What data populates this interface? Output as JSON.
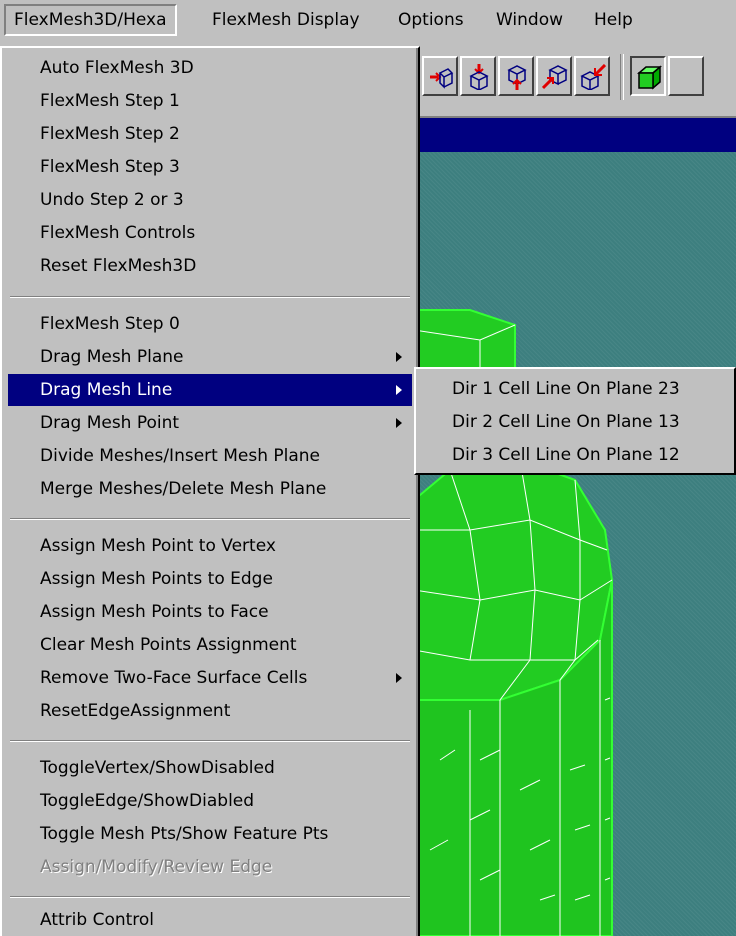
{
  "menubar": {
    "items": [
      "FlexMesh3D/Hexa",
      "FlexMesh Display",
      "Options",
      "Window",
      "Help"
    ]
  },
  "colors": {
    "menu_bg": "#c0c0c0",
    "highlight": "#000080",
    "viewport_bg": "#3d7f7f",
    "mesh_green": "#22cc22",
    "toolbar_icon_red": "#e00000",
    "toolbar_icon_blue": "#000080"
  },
  "toolbar": {
    "icons": [
      "face-offset-icon",
      "face-drop-icon",
      "face-pin-icon",
      "face-arrow-icon",
      "face-corner-icon",
      "solid-cube-icon"
    ]
  },
  "dropdown": {
    "groups": [
      [
        {
          "label": "Auto FlexMesh 3D"
        },
        {
          "label": "FlexMesh Step 1"
        },
        {
          "label": "FlexMesh Step 2"
        },
        {
          "label": "FlexMesh Step 3"
        },
        {
          "label": "Undo Step 2 or 3"
        },
        {
          "label": "FlexMesh Controls"
        },
        {
          "label": "Reset FlexMesh3D"
        }
      ],
      [
        {
          "label": "FlexMesh Step 0"
        },
        {
          "label": "Drag Mesh Plane",
          "submenu": true
        },
        {
          "label": "Drag Mesh Line",
          "submenu": true,
          "highlighted": true
        },
        {
          "label": "Drag Mesh Point",
          "submenu": true
        },
        {
          "label": "Divide Meshes/Insert Mesh Plane"
        },
        {
          "label": "Merge Meshes/Delete Mesh Plane"
        }
      ],
      [
        {
          "label": "Assign Mesh Point to Vertex"
        },
        {
          "label": "Assign Mesh Points to Edge"
        },
        {
          "label": "Assign Mesh Points to Face"
        },
        {
          "label": "Clear Mesh Points Assignment"
        },
        {
          "label": "Remove Two-Face Surface Cells",
          "submenu": true
        },
        {
          "label": "ResetEdgeAssignment"
        }
      ],
      [
        {
          "label": "ToggleVertex/ShowDisabled"
        },
        {
          "label": "ToggleEdge/ShowDiabled"
        },
        {
          "label": "Toggle Mesh Pts/Show Feature Pts"
        },
        {
          "label": "Assign/Modify/Review Edge",
          "disabled": true
        }
      ],
      [
        {
          "label": "Attrib Control"
        }
      ]
    ]
  },
  "submenu": {
    "items": [
      "Dir 1 Cell Line On Plane 23",
      "Dir 2 Cell Line On Plane 13",
      "Dir 3 Cell Line On Plane 12"
    ]
  }
}
